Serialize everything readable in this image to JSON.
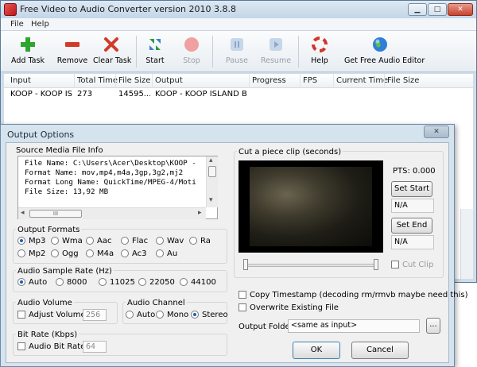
{
  "main": {
    "title": "Free Video to Audio Converter version 2010  3.8.8",
    "window_buttons": {
      "minimize": "▁",
      "maximize": "□",
      "close": "✕"
    },
    "menu": [
      "File",
      "Help"
    ],
    "toolbar": [
      {
        "label": "Add Task",
        "icon": "add-icon",
        "enabled": true
      },
      {
        "label": "Remove",
        "icon": "remove-icon",
        "enabled": true
      },
      {
        "label": "Clear Task",
        "icon": "clear-icon",
        "enabled": true
      },
      {
        "label": "Start",
        "icon": "start-icon",
        "enabled": true
      },
      {
        "label": "Stop",
        "icon": "stop-icon",
        "enabled": false
      },
      {
        "label": "Pause",
        "icon": "pause-icon",
        "enabled": false
      },
      {
        "label": "Resume",
        "icon": "resume-icon",
        "enabled": false
      },
      {
        "label": "Help",
        "icon": "help-icon",
        "enabled": true
      },
      {
        "label": "Get Free Audio Editor",
        "icon": "globe-icon",
        "enabled": true
      }
    ],
    "columns": [
      "Input",
      "Total Time",
      "File Size",
      "Output",
      "Progress",
      "FPS",
      "Current Time",
      "File Size"
    ],
    "rows": [
      {
        "input": "KOOP - KOOP IS...",
        "total_time": "273",
        "file_size": "14595...",
        "output": "KOOP - KOOP ISLAND BLU...",
        "progress": "",
        "fps": "",
        "current_time": "",
        "out_size": ""
      }
    ]
  },
  "dialog": {
    "title": "Output Options",
    "close": "✕",
    "source_info": {
      "label": "Source Media File Info",
      "lines": [
        "File Name: C:\\Users\\Acer\\Desktop\\KOOP -",
        "Format Name: mov,mp4,m4a,3gp,3g2,mj2",
        "Format Long Name: QuickTime/MPEG-4/Moti",
        "File Size: 13,92 MB"
      ],
      "hscroll_grip": "III",
      "left_arrow": "◂",
      "right_arrow": "▸",
      "up_arrow": "▴",
      "down_arrow": "▾"
    },
    "output_formats": {
      "label": "Output Formats",
      "row1": [
        "Mp3",
        "Wma",
        "Aac",
        "Flac",
        "Wav",
        "Ra"
      ],
      "row2": [
        "Mp2",
        "Ogg",
        "M4a",
        "Ac3",
        "Au"
      ],
      "selected": "Mp3"
    },
    "sample_rate": {
      "label": "Audio Sample Rate (Hz)",
      "options": [
        "Auto",
        "8000",
        "11025",
        "22050",
        "44100"
      ],
      "selected": "Auto"
    },
    "audio_volume": {
      "label": "Audio Volume",
      "checkbox": "Adjust Volume",
      "value": "256"
    },
    "audio_channel": {
      "label": "Audio Channel",
      "options": [
        "Auto",
        "Mono",
        "Stereo"
      ],
      "selected": "Stereo"
    },
    "bit_rate": {
      "label": "Bit Rate (Kbps)",
      "checkbox": "Audio Bit Rate",
      "value": "64"
    },
    "clip": {
      "label": "Cut a piece clip (seconds)",
      "pts": "PTS: 0.000",
      "set_start": "Set Start",
      "start_value": "N/A",
      "set_end": "Set End",
      "end_value": "N/A",
      "cut_clip": "Cut Clip"
    },
    "copy_timestamp": "Copy Timestamp (decoding rm/rmvb maybe need this)",
    "overwrite": "Overwrite Existing File",
    "output_folder": {
      "label": "Output Folder",
      "value": "<same as input>",
      "browse": "..."
    },
    "ok": "OK",
    "cancel": "Cancel"
  }
}
